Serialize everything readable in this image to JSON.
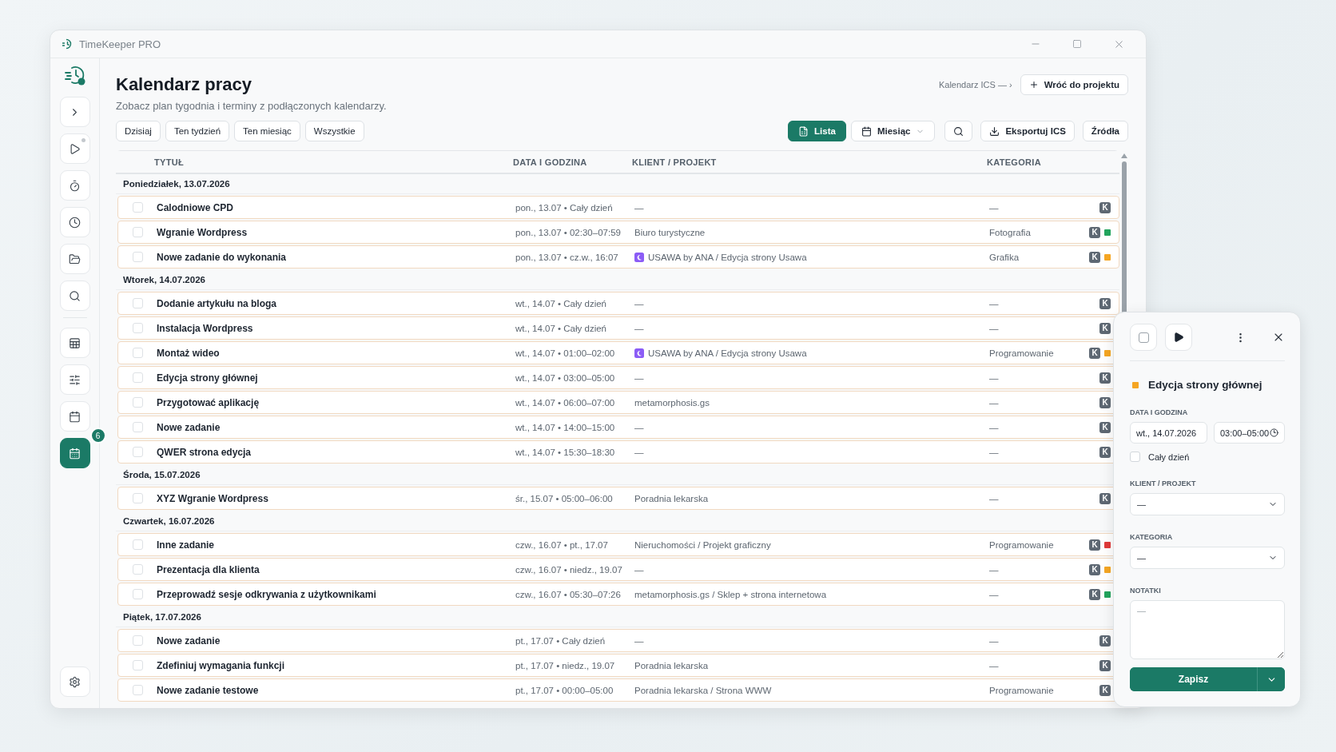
{
  "window": {
    "title": "TimeKeeper PRO"
  },
  "sidebar": {
    "items": [
      {
        "kind": "expand",
        "selected": false
      },
      {
        "kind": "play",
        "selected": false
      },
      {
        "kind": "timer",
        "selected": false
      },
      {
        "kind": "clock",
        "selected": false
      },
      {
        "kind": "folder",
        "selected": false
      },
      {
        "kind": "search",
        "selected": false
      },
      {
        "kind": "table",
        "selected": false
      },
      {
        "kind": "sliders",
        "selected": false
      },
      {
        "kind": "calendar",
        "selected": false
      },
      {
        "kind": "calendar-grid",
        "selected": true,
        "badge": "6"
      },
      {
        "kind": "settings",
        "selected": false
      }
    ]
  },
  "header": {
    "title": "Kalendarz pracy",
    "subtitle": "Zobacz plan tygodnia i terminy z podłączonych kalendarzy.",
    "ics_link": "Kalendarz ICS — ›",
    "back_button": "Wróć do projektu"
  },
  "filters": [
    {
      "label": "Dzisiaj",
      "selected": false
    },
    {
      "label": "Ten tydzień",
      "selected": false
    },
    {
      "label": "Ten miesiąc",
      "selected": false
    },
    {
      "label": "Wszystkie",
      "selected": false
    }
  ],
  "toolbar": {
    "views": [
      {
        "kind": "list",
        "label": "Lista",
        "selected": true
      },
      {
        "kind": "month",
        "label": "Miesiąc",
        "selected": false
      }
    ],
    "export": "Eksportuj ICS",
    "sources": "Źródła"
  },
  "table": {
    "columns": [
      "TYTUŁ",
      "DATA I GODZINA",
      "KLIENT / PROJEKT",
      "KATEGORIA"
    ],
    "groups": [
      {
        "label": "Poniedziałek, 13.07.2026",
        "rows": [
          {
            "title": "Calodniowe CPD",
            "date": "pon., 13.07 • Cały dzień",
            "client": "—",
            "category": "—",
            "tag": "K",
            "checked": false
          },
          {
            "title": "Wgranie Wordpress",
            "date": "pon., 13.07 • 02:30–07:59",
            "client": "Biuro turystyczne",
            "category": "Fotografia",
            "tag": "K",
            "checked": false,
            "color": "#22a45d"
          },
          {
            "title": "Nowe zadanie do wykonania",
            "date": "pon., 13.07 • cz.w., 16:07",
            "client": "USAWA by ANA / Edycja strony Usawa",
            "client_icon": true,
            "category": "Grafika",
            "tag": "K",
            "checked": false,
            "color": "#f5a623"
          }
        ]
      },
      {
        "label": "Wtorek, 14.07.2026",
        "rows": [
          {
            "title": "Dodanie artykułu na bloga",
            "date": "wt., 14.07 • Cały dzień",
            "client": "—",
            "category": "—",
            "tag": "K",
            "checked": false
          },
          {
            "title": "Instalacja Wordpress",
            "date": "wt., 14.07 • Cały dzień",
            "client": "—",
            "category": "—",
            "tag": "K",
            "checked": false
          },
          {
            "title": "Montaż wideo",
            "date": "wt., 14.07 • 01:00–02:00",
            "client": "USAWA by ANA / Edycja strony Usawa",
            "client_icon": true,
            "category": "Programowanie",
            "tag": "K",
            "checked": false,
            "color": "#f5a623"
          },
          {
            "title": "Edycja strony głównej",
            "date": "wt., 14.07 • 03:00–05:00",
            "client": "—",
            "category": "—",
            "tag": "K",
            "checked": false
          },
          {
            "title": "Przygotować aplikację",
            "date": "wt., 14.07 • 06:00–07:00",
            "client": "metamorphosis.gs",
            "category": "—",
            "tag": "K",
            "checked": false
          },
          {
            "title": "Nowe zadanie",
            "date": "wt., 14.07 • 14:00–15:00",
            "client": "—",
            "category": "—",
            "tag": "K",
            "checked": false
          },
          {
            "title": "QWER strona edycja",
            "date": "wt., 14.07 • 15:30–18:30",
            "client": "—",
            "category": "—",
            "tag": "K",
            "checked": false
          }
        ]
      },
      {
        "label": "Środa, 15.07.2026",
        "rows": [
          {
            "title": "XYZ Wgranie Wordpress",
            "date": "śr., 15.07 • 05:00–06:00",
            "client": "Poradnia lekarska",
            "category": "—",
            "tag": "K",
            "checked": false
          }
        ]
      },
      {
        "label": "Czwartek, 16.07.2026",
        "rows": [
          {
            "title": "Inne zadanie",
            "date": "czw., 16.07 • pt., 17.07",
            "client": "Nieruchomości / Projekt graficzny",
            "category": "Programowanie",
            "tag": "K",
            "checked": false,
            "color": "#e03a3a"
          },
          {
            "title": "Prezentacja dla klienta",
            "date": "czw., 16.07 • niedz., 19.07",
            "client": "—",
            "category": "—",
            "tag": "K",
            "checked": false,
            "color": "#f5a623"
          },
          {
            "title": "Przeprowadź sesje odkrywania z użytkownikami",
            "date": "czw., 16.07 • 05:30–07:26",
            "client": "metamorphosis.gs / Sklep + strona internetowa",
            "category": "—",
            "tag": "K",
            "checked": false,
            "color": "#22a45d"
          }
        ]
      },
      {
        "label": "Piątek, 17.07.2026",
        "rows": [
          {
            "title": "Nowe zadanie",
            "date": "pt., 17.07 • Cały dzień",
            "client": "—",
            "category": "—",
            "tag": "K",
            "checked": false
          },
          {
            "title": "Zdefiniuj wymagania funkcji",
            "date": "pt., 17.07 • niedz., 19.07",
            "client": "Poradnia lekarska",
            "category": "—",
            "tag": "K",
            "checked": false
          },
          {
            "title": "Nowe zadanie testowe",
            "date": "pt., 17.07 • 00:00–05:00",
            "client": "Poradnia lekarska / Strona WWW",
            "category": "Programowanie",
            "tag": "K",
            "checked": false
          }
        ]
      }
    ]
  },
  "detail": {
    "done": false,
    "title": "Edycja strony głównej",
    "color": "#f5a623",
    "date_label": "DATA I GODZINA",
    "date": "wt., 14.07.2026",
    "time": "03:00–05:00",
    "all_day": {
      "label": "Cały dzień",
      "checked": false
    },
    "client_label": "KLIENT / PROJEKT",
    "client": "—",
    "category_label": "KATEGORIA",
    "category": "—",
    "notes_label": "NOTATKI",
    "notes_placeholder": "—",
    "save": "Zapisz"
  }
}
